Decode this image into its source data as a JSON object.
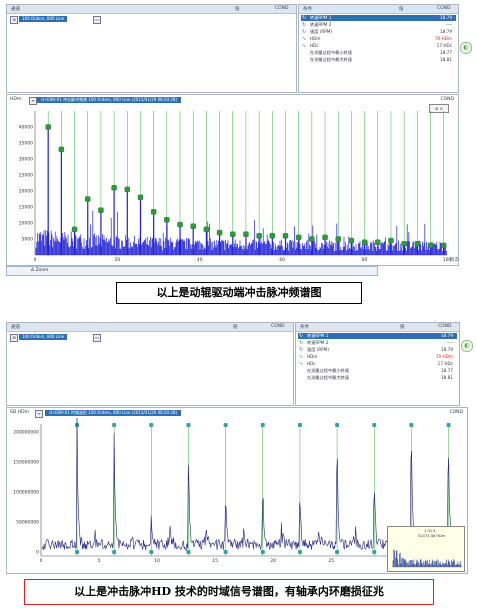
{
  "figure1": {
    "list_panel": {
      "col_left": "通道",
      "col_mid": "值",
      "col_right": "COND",
      "selected_item": "100 Orders, 800 Line"
    },
    "params_panel": {
      "col_left": "条件",
      "col_mid": "值",
      "col_right": "COND",
      "rows": [
        {
          "label": "转速RPM 1",
          "value": "18.79",
          "icon": "speed-icon",
          "selected": true
        },
        {
          "label": "转速RPM 2",
          "value": "----",
          "icon": "speed-icon"
        },
        {
          "label": "速度 (RPM)",
          "value": "18.79",
          "icon": "speed-icon"
        },
        {
          "label": "HDm",
          "value": "70 HDm",
          "icon": "wave-icon",
          "alarm": true
        },
        {
          "label": "HDc",
          "value": "17 HDc",
          "icon": "wave-icon"
        },
        {
          "label": "在测量过程中最小转速",
          "value": "18.77",
          "icon": "none"
        },
        {
          "label": "在测量过程中最大转速",
          "value": "18.81",
          "icon": "none"
        }
      ]
    },
    "chart_header": {
      "ylabel": "HDm",
      "title": "ch-ENV-01  冲击脉冲频谱  100 Orders, 800 Line  (2015/01/29 08:20:28)",
      "unit_right": "COND"
    },
    "bottom_strip": "∆ Zoom",
    "caption": "以上是动辊驱动端冲击脉冲频谱图"
  },
  "figure2": {
    "list_panel": {
      "col_left": "通道",
      "col_mid": "值",
      "col_right": "COND",
      "selected_item": "100 Orders, 800 Line"
    },
    "params_panel": {
      "col_left": "条件",
      "col_mid": "值",
      "col_right": "COND",
      "rows": [
        {
          "label": "转速RPM 1",
          "value": "18.79",
          "icon": "speed-icon",
          "selected": true
        },
        {
          "label": "转速RPM 2",
          "value": "----",
          "icon": "speed-icon"
        },
        {
          "label": "速度 (RPM)",
          "value": "18.79",
          "icon": "speed-icon"
        },
        {
          "label": "HDm",
          "value": "70 HDm",
          "icon": "wave-icon",
          "alarm": true
        },
        {
          "label": "HDc",
          "value": "17 HDc",
          "icon": "wave-icon"
        },
        {
          "label": "在测量过程中最小转速",
          "value": "18.77",
          "icon": "none"
        },
        {
          "label": "在测量过程中最大转速",
          "value": "18.81",
          "icon": "none"
        }
      ]
    },
    "chart_header": {
      "ylabel": "SD HDm",
      "title": "ch-ENV-01  时域波形  100 Orders, 800 Line  (2015/01/29 08:20:28)",
      "unit_right": "COND"
    },
    "inset": {
      "label1": "1  32.3",
      "label2": "52073.48 HDm"
    },
    "caption": "以上是冲击脉冲HD 技术的时域信号谱图，有轴承内环磨损征兆"
  },
  "colors": {
    "spectrum": "#1f1fd8",
    "harmonic_line": "#3cb043",
    "marker": "#2e9a3a",
    "wave": "#22227a",
    "accent": "#2f6fb0",
    "caption_border": "#e02020"
  },
  "chart_data": [
    {
      "type": "bar",
      "title": "",
      "xlabel": "阶次",
      "ylabel": "HDm",
      "xlim": [
        0,
        100
      ],
      "ylim": [
        0,
        45000
      ],
      "x_ticks": [
        0,
        20,
        40,
        60,
        80,
        100
      ],
      "y_ticks": [
        5000,
        10000,
        15000,
        20000,
        25000,
        30000,
        35000,
        40000
      ],
      "noise_floor": 3000,
      "harmonic_markers": {
        "x": [
          3.2,
          6.4,
          9.6,
          12.8,
          16.0,
          19.2,
          22.4,
          25.6,
          28.8,
          32.0,
          35.2,
          38.4,
          41.6,
          44.8,
          48.0,
          51.2,
          54.4,
          57.6,
          60.8,
          64.0,
          67.2,
          70.4,
          73.6,
          76.8,
          80.0,
          83.2,
          86.4,
          89.6,
          92.8,
          96.0,
          99.2
        ],
        "y": [
          40000,
          33000,
          8000,
          17500,
          14000,
          21000,
          20500,
          18000,
          13500,
          11000,
          9500,
          9000,
          8000,
          7000,
          6500,
          6500,
          6000,
          6000,
          6000,
          5500,
          5000,
          5500,
          5000,
          4500,
          4000,
          4000,
          4500,
          3500,
          3500,
          3000,
          3000
        ]
      },
      "grid": false
    },
    {
      "type": "line",
      "title": "",
      "xlabel": "",
      "ylabel": "SD HDm",
      "xlim": [
        0,
        36
      ],
      "ylim": [
        0,
        220000000
      ],
      "x_ticks": [
        0,
        5,
        10,
        15,
        20,
        25,
        30,
        35
      ],
      "y_ticks": [
        0,
        50000000,
        100000000,
        150000000,
        200000000
      ],
      "impact_period": 3.19,
      "impact_times": [
        3.1,
        6.3,
        9.5,
        12.7,
        15.9,
        19.1,
        22.3,
        25.5,
        28.7,
        31.9,
        35.1
      ],
      "impact_peaks": [
        195000000,
        170000000,
        60000000,
        170000000,
        95000000,
        100000000,
        90000000,
        170000000,
        110000000,
        190000000,
        175000000
      ],
      "grid": false
    }
  ]
}
